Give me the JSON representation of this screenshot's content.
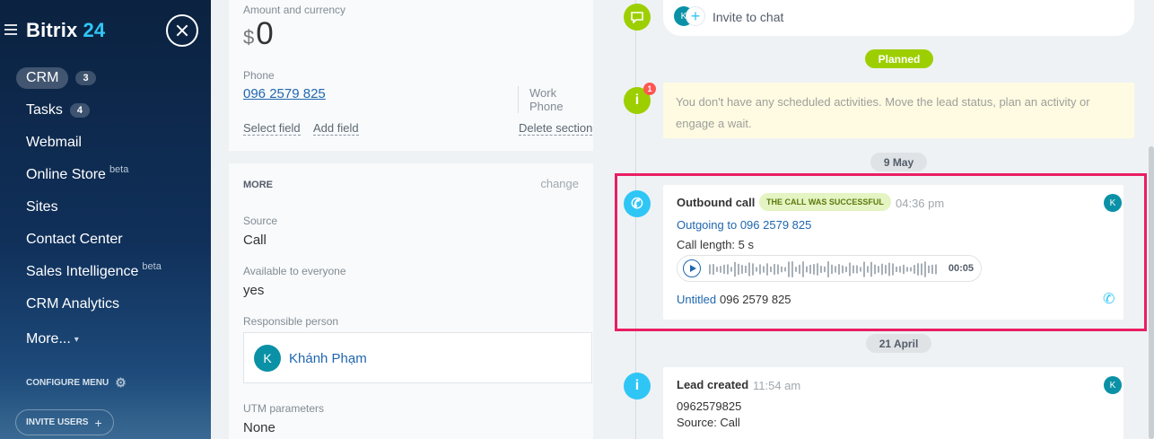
{
  "sidebar": {
    "brand_main": "Bitrix",
    "brand_accent": "24",
    "items": [
      {
        "label": "CRM",
        "counter": "3"
      },
      {
        "label": "Tasks",
        "counter": "4"
      },
      {
        "label": "Webmail"
      },
      {
        "label": "Online Store",
        "sup": "beta"
      },
      {
        "label": "Sites"
      },
      {
        "label": "Contact Center"
      },
      {
        "label": "Sales Intelligence",
        "sup": "beta"
      },
      {
        "label": "CRM Analytics"
      },
      {
        "label": "More...",
        "caret": "▾"
      }
    ],
    "configure_label": "CONFIGURE MENU",
    "invite_label": "INVITE USERS"
  },
  "details": {
    "amount_label": "Amount and currency",
    "amount_currency": "$",
    "amount_value": "0",
    "phone_label": "Phone",
    "phone_value": "096 2579 825",
    "phone_type": "Work Phone",
    "select_field": "Select field",
    "add_field": "Add field",
    "delete_section": "Delete section",
    "more_title": "MORE",
    "change_label": "change",
    "source_label": "Source",
    "source_value": "Call",
    "available_label": "Available to everyone",
    "available_value": "yes",
    "responsible_label": "Responsible person",
    "responsible_initial": "K",
    "responsible_name": "Khánh Phạm",
    "utm_label": "UTM parameters",
    "utm_value": "None"
  },
  "timeline": {
    "invite_avatar": "K",
    "invite_plus": "+",
    "invite_text": "Invite to chat",
    "planned_label": "Planned",
    "warning_count": "1",
    "warning_text": "You don't have any scheduled activities. Move the lead status, plan an activity or engage a wait.",
    "date1": "9 May",
    "call": {
      "title": "Outbound call",
      "status": "THE CALL WAS SUCCESSFUL",
      "time": "04:36 pm",
      "avatar": "K",
      "outgoing": "Outgoing to 096 2579 825",
      "length": "Call length: 5 s",
      "duration": "00:05",
      "untitled_link": "Untitled",
      "untitled_number": "096 2579 825"
    },
    "date2": "21 April",
    "lead": {
      "title": "Lead created",
      "time": "11:54 am",
      "avatar": "K",
      "phone": "0962579825",
      "source": "Source: Call"
    }
  },
  "colors": {
    "accent_blue": "#2fc6f6",
    "accent_green": "#9dcf00",
    "highlight": "#e91e63",
    "link": "#2067b0"
  },
  "icons": [
    "menu-icon",
    "close-icon",
    "gear-icon",
    "plus-icon",
    "chat-icon",
    "info-icon",
    "phone-icon",
    "play-icon"
  ]
}
